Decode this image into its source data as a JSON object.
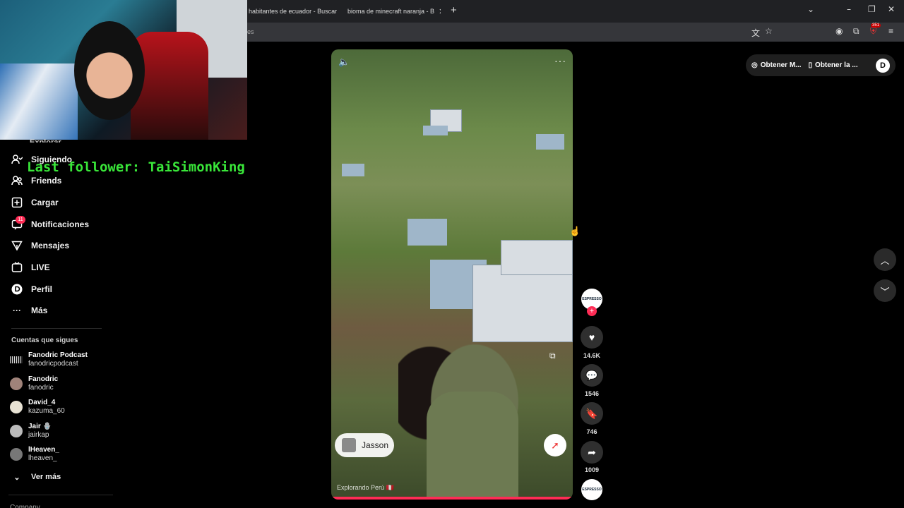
{
  "browser": {
    "tabs": [
      {
        "title": "habitantes de ecuador - Buscar"
      },
      {
        "title": "bioma de minecraft naranja - B"
      }
    ],
    "address_fragment": "es",
    "ext_badge": "351"
  },
  "overlay": {
    "follower_text": "Last follower: TaiSimonKing"
  },
  "sidebar": {
    "partial_top": "Explorar",
    "items": [
      {
        "label": "Siguiendo",
        "icon": "following-icon"
      },
      {
        "label": "Friends",
        "icon": "friends-icon"
      },
      {
        "label": "Cargar",
        "icon": "upload-icon"
      },
      {
        "label": "Notificaciones",
        "icon": "notifications-icon",
        "badge": "11"
      },
      {
        "label": "Mensajes",
        "icon": "messages-icon"
      },
      {
        "label": "LIVE",
        "icon": "live-icon"
      },
      {
        "label": "Perfil",
        "icon": "profile-icon"
      },
      {
        "label": "Más",
        "icon": "more-icon"
      }
    ],
    "following_title": "Cuentas que sigues",
    "accounts": [
      {
        "name": "Fanodric Podcast",
        "user": "fanodricpodcast"
      },
      {
        "name": "Fanodric",
        "user": "fanodric"
      },
      {
        "name": "David_4",
        "user": "kazuma_60"
      },
      {
        "name": "Jair 🪬",
        "user": "jairkap"
      },
      {
        "name": "lHeaven_",
        "user": "lheaven_"
      }
    ],
    "see_more": "Ver más",
    "footer_partial": "Company"
  },
  "video": {
    "jasson_label": "Jasson",
    "caption": "Explorando Perú 🇵🇪 ",
    "progress": 1.0
  },
  "actions": {
    "creator_avatar_text": "ESPRESSO",
    "likes": "14.6K",
    "comments": "1546",
    "saves": "746",
    "shares": "1009"
  },
  "getapp": {
    "item1": "Obtener M...",
    "item2": "Obtener la ..."
  },
  "colors": {
    "accent": "#fe2c55",
    "follower_text": "#39e639",
    "background": "#000000"
  }
}
